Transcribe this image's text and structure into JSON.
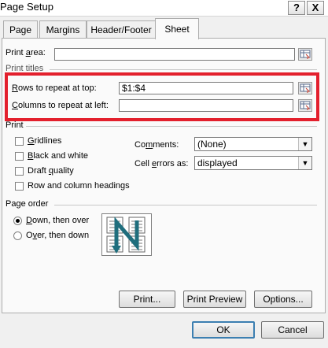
{
  "window": {
    "title": "Page Setup",
    "help_label": "?",
    "close_label": "X"
  },
  "tabs": [
    {
      "label": "Page"
    },
    {
      "label": "Margins"
    },
    {
      "label": "Header/Footer"
    },
    {
      "label": "Sheet",
      "active": true
    }
  ],
  "print_area": {
    "label_a": "Print ",
    "label_b": "a",
    "label_c": "rea:",
    "value": ""
  },
  "print_titles": {
    "group_label": "Print titles",
    "rows_label_a": "R",
    "rows_label_b": "ows to repeat at top:",
    "rows_value": "$1:$4",
    "cols_label_a": "C",
    "cols_label_b": "olumns to repeat at left:",
    "cols_value": ""
  },
  "print": {
    "group_label": "Print",
    "gridlines_a": "G",
    "gridlines_b": "ridlines",
    "bw_a": "B",
    "bw_b": "lack and white",
    "draft_a": "Draft ",
    "draft_b": "q",
    "draft_c": "uality",
    "headings_a": "Row and column headings",
    "comments_label_a": "Co",
    "comments_label_b": "m",
    "comments_label_c": "ments:",
    "comments_value": "(None)",
    "errors_label_a": "Cell ",
    "errors_label_b": "e",
    "errors_label_c": "rrors as:",
    "errors_value": "displayed"
  },
  "page_order": {
    "group_label": "Page order",
    "down_a": "D",
    "down_b": "own, then over",
    "over_a": "O",
    "over_b": "v",
    "over_c": "er, then down",
    "selected": "down-then-over"
  },
  "buttons": {
    "print": "Print...",
    "preview": "Print Preview",
    "options": "Options...",
    "ok": "OK",
    "cancel": "Cancel"
  },
  "colors": {
    "highlight": "#e3202d",
    "arrow": "#1f6e7d"
  }
}
